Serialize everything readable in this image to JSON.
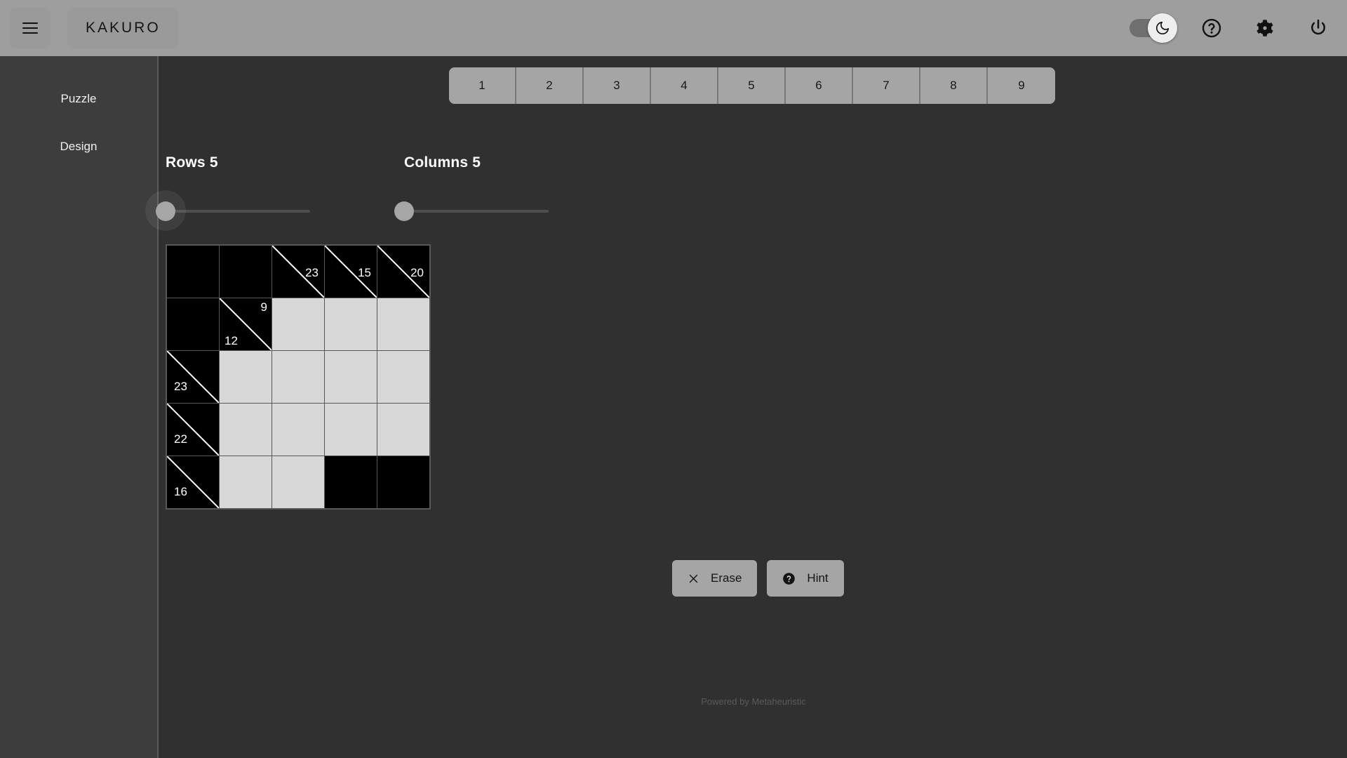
{
  "app": {
    "title": "KAKURO",
    "footer": "Powered by Metaheuristic"
  },
  "header": {
    "menu_icon": "hamburger-menu-icon",
    "theme_toggle": {
      "state": "dark",
      "icon": "moon-icon"
    },
    "help_icon": "question-circle-icon",
    "settings_icon": "gear-icon",
    "power_icon": "power-icon"
  },
  "sidebar": {
    "items": [
      {
        "label": "Puzzle"
      },
      {
        "label": "Design"
      }
    ]
  },
  "numpad": {
    "buttons": [
      "1",
      "2",
      "3",
      "4",
      "5",
      "6",
      "7",
      "8",
      "9"
    ]
  },
  "controls": {
    "rows": {
      "label": "Rows 5",
      "name": "Rows",
      "value": 5,
      "percent": 0
    },
    "columns": {
      "label": "Columns 5",
      "name": "Columns",
      "value": 5,
      "percent": 0
    }
  },
  "grid": {
    "rows": 5,
    "columns": 5,
    "cells": [
      [
        {
          "type": "block"
        },
        {
          "type": "block"
        },
        {
          "type": "clue",
          "down": "23"
        },
        {
          "type": "clue",
          "down": "15"
        },
        {
          "type": "clue",
          "down": "20"
        }
      ],
      [
        {
          "type": "block"
        },
        {
          "type": "clue",
          "down": "9",
          "across": "12"
        },
        {
          "type": "open",
          "value": ""
        },
        {
          "type": "open",
          "value": ""
        },
        {
          "type": "open",
          "value": ""
        }
      ],
      [
        {
          "type": "clue",
          "across": "23"
        },
        {
          "type": "open",
          "value": ""
        },
        {
          "type": "open",
          "value": ""
        },
        {
          "type": "open",
          "value": ""
        },
        {
          "type": "open",
          "value": ""
        }
      ],
      [
        {
          "type": "clue",
          "across": "22"
        },
        {
          "type": "open",
          "value": ""
        },
        {
          "type": "open",
          "value": ""
        },
        {
          "type": "open",
          "value": ""
        },
        {
          "type": "open",
          "value": ""
        }
      ],
      [
        {
          "type": "clue",
          "across": "16"
        },
        {
          "type": "open",
          "value": ""
        },
        {
          "type": "open",
          "value": ""
        },
        {
          "type": "block"
        },
        {
          "type": "block"
        }
      ]
    ]
  },
  "actions": {
    "erase": {
      "label": "Erase",
      "icon": "close-x-icon"
    },
    "hint": {
      "label": "Hint",
      "icon": "question-mark-filled-icon"
    }
  },
  "colors": {
    "header_bg": "#9e9e9e",
    "sidebar_bg": "#3d3d3d",
    "main_bg": "#303030",
    "block_cell": "#000000",
    "open_cell": "#d8d8d8",
    "button_bg": "#a5a5a5"
  }
}
